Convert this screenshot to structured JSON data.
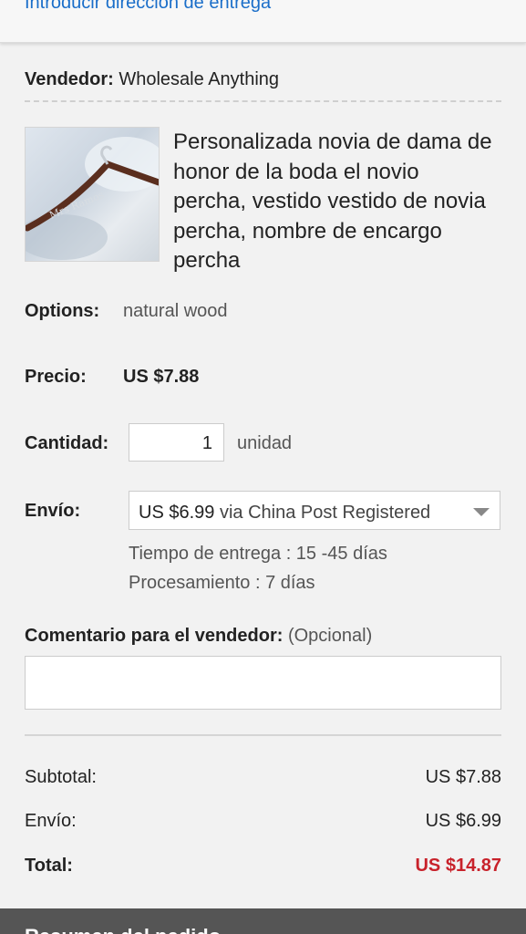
{
  "header": {
    "link_text": "Introducir dirección de entrega"
  },
  "seller": {
    "label": "Vendedor:",
    "name": "Wholesale Anything"
  },
  "product": {
    "title": "Personalizada novia de dama de honor de la boda el novio percha, vestido vestido de novia percha, nombre de encargo percha",
    "image_icon": "hanger-photo"
  },
  "options": {
    "label": "Options:",
    "value": "natural wood"
  },
  "price": {
    "label": "Precio:",
    "value": "US $7.88"
  },
  "quantity": {
    "label": "Cantidad:",
    "value": "1",
    "unit": "unidad"
  },
  "shipping": {
    "label": "Envío:",
    "price": "US $6.99",
    "method": "via China Post Registered",
    "delivery_time": "Tiempo de entrega : 15 -45 días",
    "processing": "Procesamiento : 7 días"
  },
  "comment": {
    "label": "Comentario para el vendedor:",
    "optional": "(Opcional)",
    "value": ""
  },
  "summary": {
    "subtotal_label": "Subtotal:",
    "subtotal_value": "US $7.88",
    "shipping_label": "Envío:",
    "shipping_value": "US $6.99",
    "total_label": "Total:",
    "total_value": "US $14.87"
  },
  "footer": {
    "text": "Resumen del pedido"
  },
  "colors": {
    "link": "#1a6ec9",
    "total": "#c8222b",
    "footer_bg": "#555555"
  }
}
